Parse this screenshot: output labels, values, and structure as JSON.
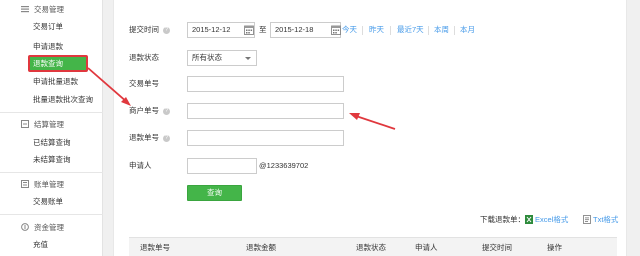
{
  "sidebar": {
    "groups": [
      {
        "title": "交易管理",
        "icon": "list-icon",
        "items": [
          "交易订单",
          "申请退款",
          "退款查询",
          "申请批量退款",
          "批量退款批次查询"
        ]
      },
      {
        "title": "结算管理",
        "icon": "settlement-icon",
        "items": [
          "已结算查询",
          "未结算查询"
        ]
      },
      {
        "title": "账单管理",
        "icon": "bill-icon",
        "items": [
          "交易账单"
        ]
      },
      {
        "title": "资金管理",
        "icon": "fund-icon",
        "items": [
          "充值"
        ]
      }
    ],
    "active_item": "退款查询"
  },
  "form": {
    "submit_time_label": "提交时间",
    "date_start": "2015-12-12",
    "date_sep": "至",
    "date_end": "2015-12-18",
    "quick_ranges": [
      "今天",
      "昨天",
      "最近7天",
      "本周",
      "本月"
    ],
    "refund_status_label": "退款状态",
    "refund_status_value": "所有状态",
    "trade_no_label": "交易单号",
    "merchant_no_label": "商户单号",
    "refund_no_label": "退款单号",
    "applicant_label": "申请人",
    "applicant_suffix": "@1233639702",
    "search_button": "查询"
  },
  "download": {
    "label": "下载退款单：",
    "excel": "Excel格式",
    "txt": "Txt格式"
  },
  "table": {
    "headers": [
      "退款单号",
      "退款金额",
      "退款状态",
      "申请人",
      "提交时间",
      "操作"
    ]
  },
  "colors": {
    "accent_green": "#44b549",
    "link_blue": "#459ae9",
    "annotation_red": "#e0383e"
  }
}
